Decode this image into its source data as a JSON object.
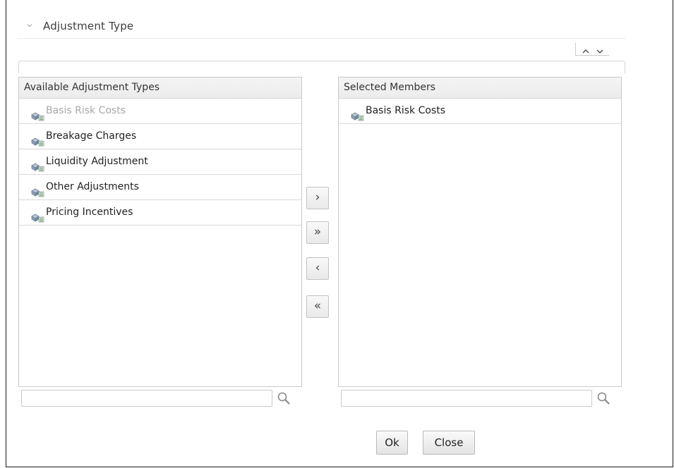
{
  "section": {
    "title": "Adjustment Type"
  },
  "available": {
    "header": "Available Adjustment Types",
    "items": [
      {
        "label": "Basis Risk Costs",
        "icon": "member-icon"
      },
      {
        "label": "Breakage Charges",
        "icon": "member-icon"
      },
      {
        "label": "Liquidity Adjustment",
        "icon": "member-icon"
      },
      {
        "label": "Other Adjustments",
        "icon": "member-icon"
      },
      {
        "label": "Pricing Incentives",
        "icon": "member-icon"
      }
    ],
    "search": {
      "value": ""
    }
  },
  "selected": {
    "header": "Selected Members",
    "items": [
      {
        "label": "Basis Risk Costs",
        "icon": "member-icon"
      }
    ],
    "search": {
      "value": ""
    }
  },
  "shuttle": {
    "move_selected": "›",
    "move_all": "»",
    "remove_selected": "‹",
    "remove_all": "«"
  },
  "buttons": {
    "ok": "Ok",
    "close": "Close"
  },
  "colors": {
    "border": "#c9c9c9",
    "header_bg": "#f0f0f0",
    "disabled_text": "#a8a8a8"
  }
}
